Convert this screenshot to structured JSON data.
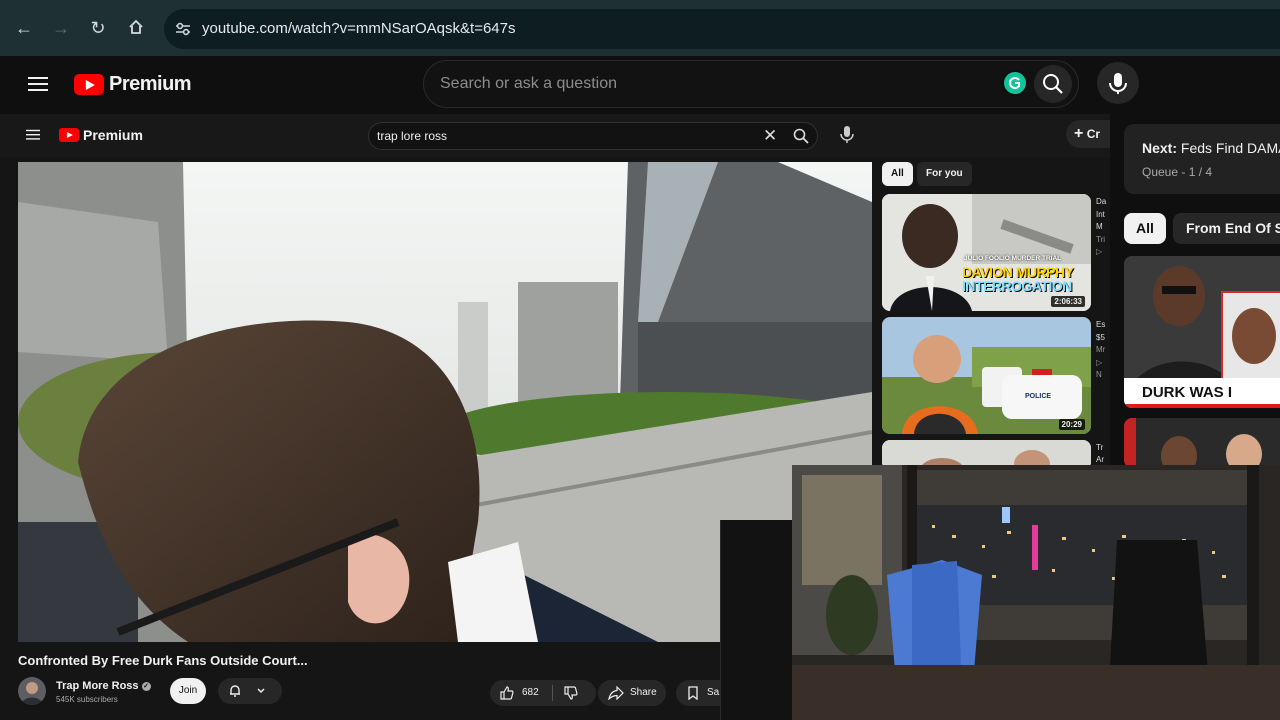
{
  "browser": {
    "url": "youtube.com/watch?v=mmNSarOAqsk&t=647s"
  },
  "header": {
    "logo_text": "Premium",
    "search_placeholder": "Search or ask a question"
  },
  "inner": {
    "logo_text": "Premium",
    "search_query": "trap lore ross",
    "create_label": "Cr",
    "chips": [
      "All",
      "For you"
    ],
    "video_title": "Confronted By Free Durk Fans Outside Court...",
    "channel_name": "Trap More Ross",
    "subscribers": "545K subscribers",
    "join_label": "Join",
    "likes": "682",
    "share_label": "Share",
    "save_label": "Sa",
    "recs": [
      {
        "overlay1": "JULIO FOOLIO MURDER TRIAL",
        "overlay2": "DAVION MURPHY",
        "overlay3": "INTERROGATION",
        "duration": "2:06:33",
        "side": [
          "Da",
          "Int",
          "M",
          "Tri",
          "▷"
        ]
      },
      {
        "overlay1": "POLICE",
        "duration": "20:29",
        "side": [
          "Es",
          "$5",
          "Mr",
          "▷",
          "N"
        ]
      },
      {
        "side": [
          "Tr",
          "Ar"
        ]
      }
    ]
  },
  "right": {
    "next_label": "Next:",
    "next_title": "Feds Find DAMA",
    "queue_text": "Queue - 1 / 4",
    "chips": [
      "All",
      "From End Of S"
    ],
    "thumb_text": "DURK WAS I"
  },
  "colors": {
    "accent": "#ff0000",
    "chrome": "#1f3034",
    "grammarly": "#15c39a"
  }
}
